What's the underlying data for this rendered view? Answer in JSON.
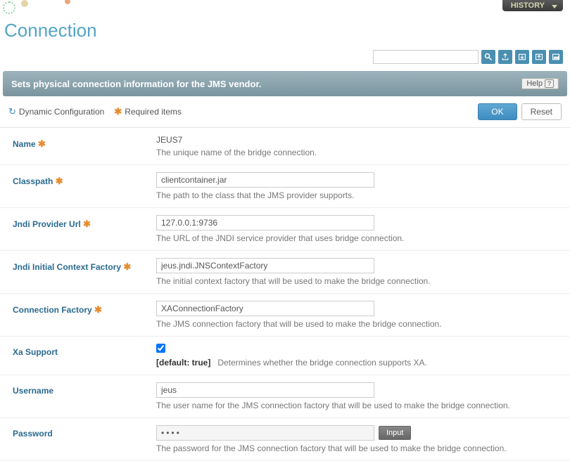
{
  "header": {
    "history_label": "HISTORY",
    "page_title": "Connection",
    "search_placeholder": ""
  },
  "banner": {
    "text": "Sets physical connection information for the JMS vendor.",
    "help_label": "Help"
  },
  "legend": {
    "dynamic_label": "Dynamic Configuration",
    "required_label": "Required items"
  },
  "buttons": {
    "ok": "OK",
    "reset": "Reset",
    "input": "Input"
  },
  "fields": {
    "name": {
      "label": "Name",
      "value": "JEUS7",
      "desc": "The unique name of the bridge connection."
    },
    "classpath": {
      "label": "Classpath",
      "value": "clientcontainer.jar",
      "desc": "The path to the class that the JMS provider supports."
    },
    "jndi_url": {
      "label": "Jndi Provider Url",
      "value": "127.0.0.1:9736",
      "desc": "The URL of the JNDI service provider that uses bridge connection."
    },
    "jndi_factory": {
      "label": "Jndi Initial Context Factory",
      "value": "jeus.jndi.JNSContextFactory",
      "desc": "The initial context factory that will be used to make the bridge connection."
    },
    "conn_factory": {
      "label": "Connection Factory",
      "value": "XAConnectionFactory",
      "desc": "The JMS connection factory that will be used to make the bridge connection."
    },
    "xa": {
      "label": "Xa Support",
      "default_hint": "[default: true]",
      "desc": "Determines whether the bridge connection supports XA."
    },
    "username": {
      "label": "Username",
      "value": "jeus",
      "desc": "The user name for the JMS connection factory that will be used to make the bridge connection."
    },
    "password": {
      "label": "Password",
      "value": "••••",
      "desc": "The password for the JMS connection factory that will be used to make the bridge connection."
    }
  }
}
